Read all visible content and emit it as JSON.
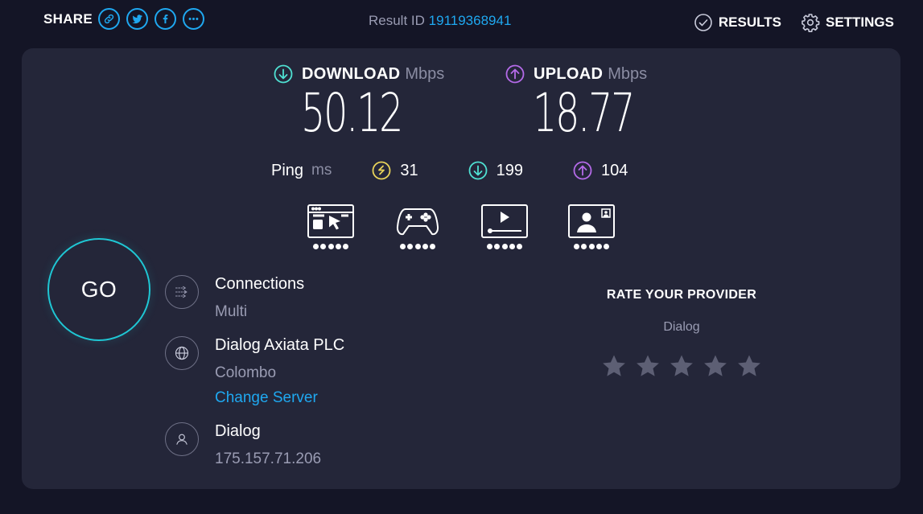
{
  "topbar": {
    "share_label": "SHARE",
    "share_buttons": [
      "link-icon",
      "twitter-icon",
      "facebook-icon",
      "more-icon"
    ],
    "result_id_label": "Result ID",
    "result_id": "19119368941",
    "results_label": "RESULTS",
    "settings_label": "SETTINGS"
  },
  "download": {
    "label": "DOWNLOAD",
    "unit": "Mbps",
    "value": "50.12",
    "color": "#4fe0d2"
  },
  "upload": {
    "label": "UPLOAD",
    "unit": "Mbps",
    "value": "18.77",
    "color": "#b46ae8"
  },
  "ping": {
    "label": "Ping",
    "unit": "ms",
    "idle": "31",
    "download": "199",
    "upload": "104",
    "idle_color": "#e8d35a"
  },
  "use_cases": [
    {
      "icon": "web-browsing-icon",
      "rating": 5
    },
    {
      "icon": "gaming-icon",
      "rating": 5
    },
    {
      "icon": "video-streaming-icon",
      "rating": 5
    },
    {
      "icon": "video-chat-icon",
      "rating": 5
    }
  ],
  "go_label": "GO",
  "connections": {
    "title": "Connections",
    "value": "Multi"
  },
  "server": {
    "name": "Dialog Axiata PLC",
    "location": "Colombo",
    "change_label": "Change Server"
  },
  "provider": {
    "name": "Dialog",
    "ip": "175.157.71.206"
  },
  "rate": {
    "title": "RATE YOUR PROVIDER",
    "provider": "Dialog",
    "stars": 5,
    "star_color": "#5d5f74"
  },
  "colors": {
    "accent": "#1fa8f0",
    "go_ring": "#1fc7d4",
    "background": "#141526",
    "card": "#242639"
  }
}
